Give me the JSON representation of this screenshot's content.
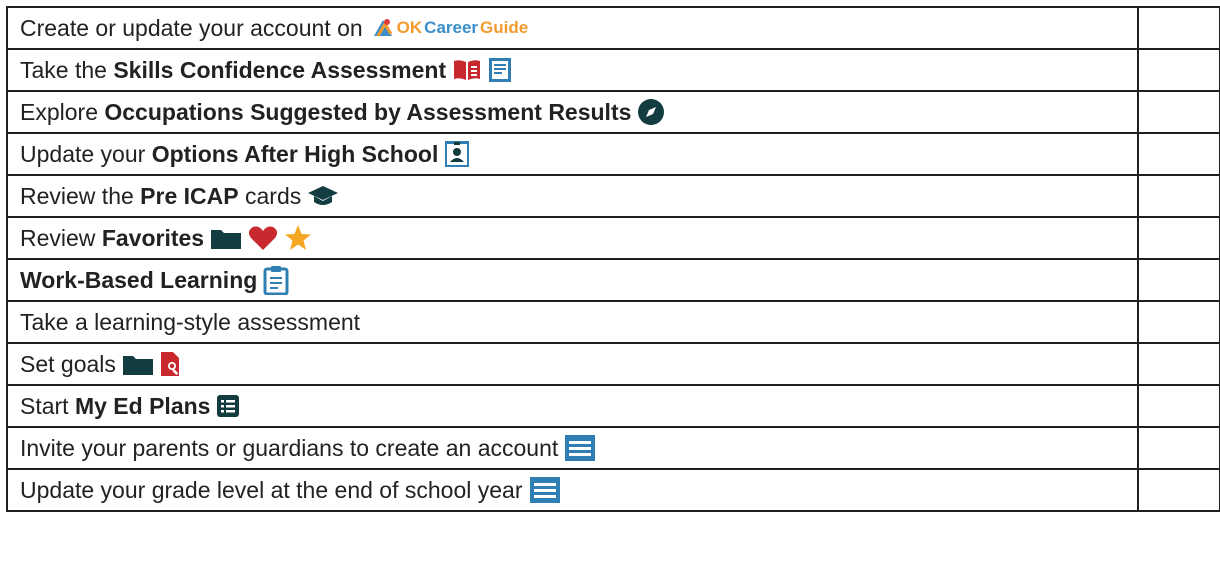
{
  "colors": {
    "border": "#1f1f1f",
    "teal_dark": "#123c3f",
    "blue": "#2f7fb5",
    "red": "#c8292f",
    "orange": "#f5a623"
  },
  "rows": [
    {
      "pre": "Create or update your account on",
      "bold": "",
      "post": "",
      "icons": [
        "okcareerguide-logo"
      ]
    },
    {
      "pre": "Take the ",
      "bold": "Skills Confidence Assessment",
      "post": "",
      "icons": [
        "red-book-icon",
        "blue-document-icon"
      ]
    },
    {
      "pre": "Explore ",
      "bold": "Occupations Suggested by Assessment Results",
      "post": "",
      "icons": [
        "compass-icon"
      ]
    },
    {
      "pre": "Update your ",
      "bold": "Options After High School",
      "post": "",
      "icons": [
        "id-badge-icon"
      ]
    },
    {
      "pre": "Review the ",
      "bold": "Pre ICAP",
      "post": " cards",
      "icons": [
        "graduation-cap-icon"
      ]
    },
    {
      "pre": "Review ",
      "bold": "Favorites",
      "post": "",
      "icons": [
        "folder-icon",
        "heart-icon",
        "star-icon"
      ]
    },
    {
      "pre": "",
      "bold": "Work-Based Learning",
      "post": "",
      "icons": [
        "clipboard-icon"
      ]
    },
    {
      "pre": "Take a learning-style assessment",
      "bold": "",
      "post": "",
      "icons": []
    },
    {
      "pre": "Set goals",
      "bold": "",
      "post": "",
      "icons": [
        "folder-icon",
        "file-search-icon"
      ]
    },
    {
      "pre": "Start ",
      "bold": "My Ed Plans",
      "post": "",
      "icons": [
        "list-icon"
      ]
    },
    {
      "pre": "Invite your parents or guardians to create an account",
      "bold": "",
      "post": "",
      "icons": [
        "menu-icon"
      ]
    },
    {
      "pre": "Update your grade level at the end of school year",
      "bold": "",
      "post": "",
      "icons": [
        "menu-icon"
      ]
    }
  ],
  "logo": {
    "ok": "OK",
    "career": "Career",
    "guide": "Guide"
  }
}
